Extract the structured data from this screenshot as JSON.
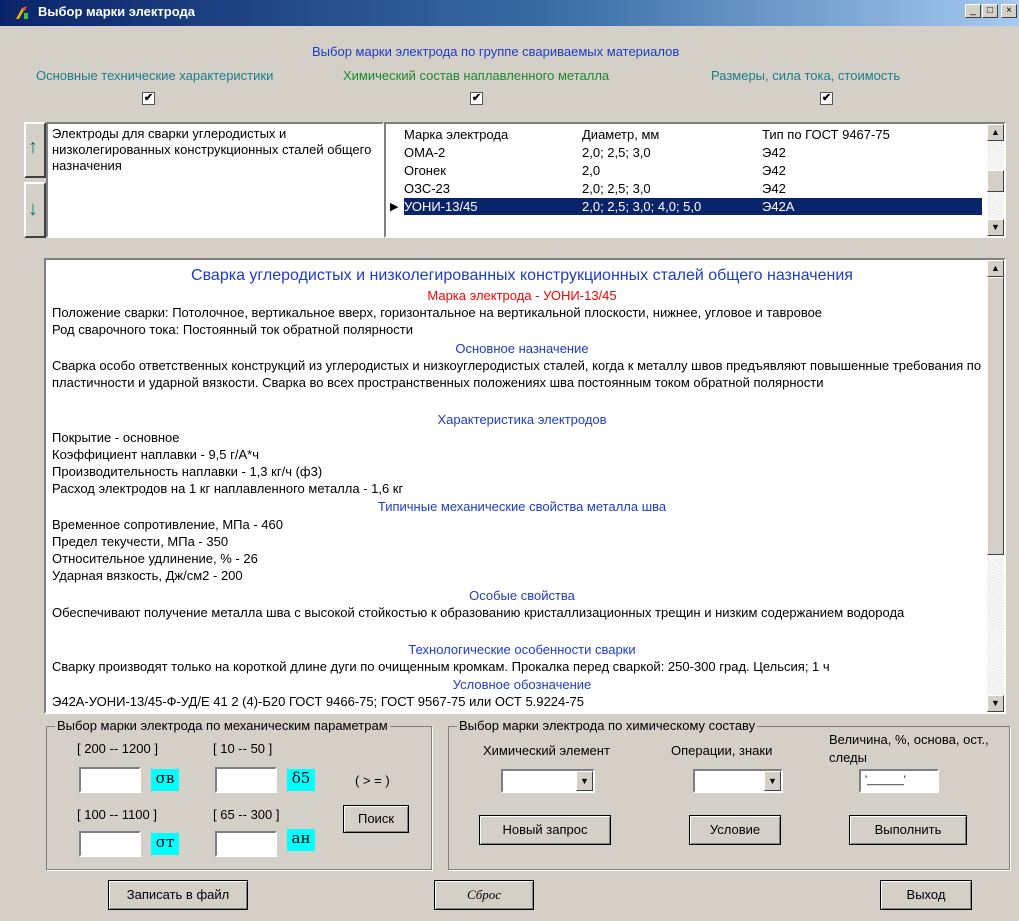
{
  "window": {
    "title": "Выбор марки электрода",
    "controls": {
      "minimize": "_",
      "maximize": "□",
      "close": "×"
    }
  },
  "header": {
    "main_title": "Выбор  марки электрода по группе свариваемых материалов",
    "options": [
      {
        "label": "Основные технические характеристики",
        "checked": "✔"
      },
      {
        "label": "Химический состав наплавленного металла",
        "checked": "✔"
      },
      {
        "label": "Размеры, сила тока, стоимость",
        "checked": "✔"
      }
    ]
  },
  "group": {
    "up_icon": "↑",
    "down_icon": "↓",
    "text": "Электроды для сварки углеродистых и низколегированных конструкционных сталей общего назначения"
  },
  "grade_table": {
    "columns": [
      "Марка электрода",
      "Диаметр, мм",
      "Тип по ГОСТ 9467-75"
    ],
    "rows": [
      [
        "ОМА-2",
        "2,0; 2,5; 3,0",
        "Э42"
      ],
      [
        "Огонек",
        "2,0",
        "Э42"
      ],
      [
        "ОЗС-23",
        "2,0; 2,5; 3,0",
        "Э42"
      ],
      [
        "УОНИ-13/45",
        "2,0; 2,5; 3,0; 4,0; 5,0",
        "Э42А"
      ]
    ],
    "row_pointer": "▶"
  },
  "info": {
    "title": "Сварка углеродистых и низколегированных  конструкционных сталей общего назначения",
    "grade_line": "Марка электрода - УОНИ-13/45",
    "position": "Положение сварки: Потолочное, вертикальное вверх, горизонтальное на вертикальной плоскости, нижнее, угловое и тавровое",
    "current": "Род сварочного тока: Постоянный ток обратной полярности",
    "h_purpose": "Основное назначение",
    "purpose": "Сварка особо ответственных конструкций из углеродистых и низкоуглеродистых сталей, когда к металлу швов предъявляют повышенные требования по пластичности и ударной вязкости. Сварка во всех пространственных положениях шва постоянным током обратной полярности",
    "h_characteristics": "Характеристика электродов",
    "char_lines": [
      "Покрытие - основное",
      "Коэффициент наплавки - 9,5 г/А*ч",
      "Производительность наплавки - 1,3 кг/ч (ф3)",
      "Расход электродов на 1 кг наплавленного металла - 1,6 кг"
    ],
    "h_mechanical": "Типичные механические свойства металла шва",
    "mech_lines": [
      "Временное сопротивление, МПа - 460",
      "Предел текучести, МПа - 350",
      "Относительное удлинение, % - 26",
      "Ударная вязкость, Дж/см2 - 200"
    ],
    "h_special": "Особые свойства",
    "special": "Обеспечивают получение металла шва с высокой стойкостью к образованию кристаллизационных трещин и низким содержанием водорода",
    "h_tech": "Технологические особенности сварки",
    "tech": "Сварку производят только на короткой длине дуги по очищенным кромкам. Прокалка перед сваркой: 250-300 град. Цельсия; 1 ч",
    "h_designation": "Условное обозначение",
    "designation": "Э42А-УОНИ-13/45-Ф-УД/Е 41 2 (4)-Б20   ГОСТ 9466-75; ГОСТ 9567-75 или ОСТ 5.9224-75"
  },
  "mech_search": {
    "legend": "Выбор марки электрода по механическим параметрам",
    "range1": "[ 200 -- 1200 ]",
    "range2": "[ 10 -- 50 ]",
    "range3": "[ 100 -- 1100 ]",
    "range4": "[ 65 -- 300 ]",
    "sym1": "σв",
    "sym2": "δ5",
    "sym3": "σт",
    "sym4": "aн",
    "compare": "( > = )",
    "search_button": "Поиск"
  },
  "chem_search": {
    "legend": "Выбор марки электрода по химическому составу",
    "element_label": "Химический элемент",
    "operations_label": "Операции, знаки",
    "value_label": "Величина, %, основа, ост., следы",
    "value_input": "'______'",
    "new_query_button": "Новый запрос",
    "condition_button": "Условие",
    "execute_button": "Выполнить"
  },
  "footer": {
    "save_button": "Записать в файл",
    "reset_button": "Сброс",
    "exit_button": "Выход"
  }
}
